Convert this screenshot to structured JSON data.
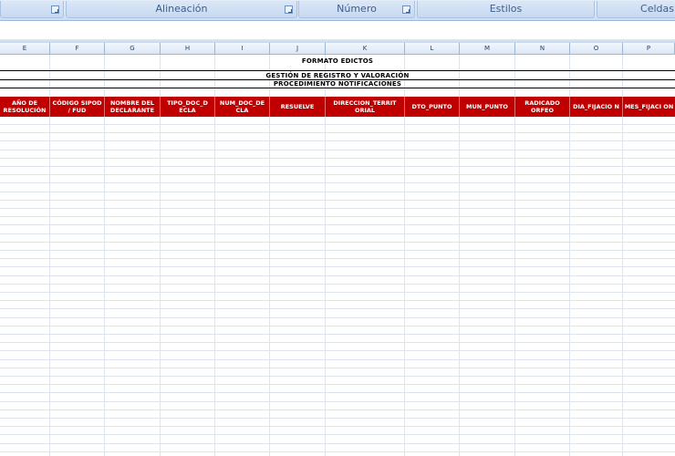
{
  "ribbon": {
    "groups": [
      {
        "label": ""
      },
      {
        "label": "Alineación"
      },
      {
        "label": "Número"
      },
      {
        "label": "Estilos"
      },
      {
        "label": "Celdas"
      }
    ]
  },
  "columns": [
    "E",
    "F",
    "G",
    "H",
    "I",
    "J",
    "K",
    "L",
    "M",
    "N",
    "O",
    "P"
  ],
  "sheet": {
    "title1": "FORMATO EDICTOS",
    "title2": "GESTIÓN DE REGISTRO Y VALORACIÓN",
    "title3": "PROCEDIMIENTO NOTIFICACIONES",
    "headers": [
      "AÑO DE RESOLUCIÓN",
      "CÓDIGO SIPOD / FUD",
      "NOMBRE DEL DECLARANTE",
      "TIPO_DOC_D ECLA",
      "NUM_DOC_DE CLA",
      "RESUELVE",
      "DIRECCION_TERRIT ORIAL",
      "DTO_PUNTO",
      "MUN_PUNTO",
      "RADICADO ORFEO",
      "DIA_FIJACIO N",
      "MES_FIJACI ON"
    ]
  }
}
